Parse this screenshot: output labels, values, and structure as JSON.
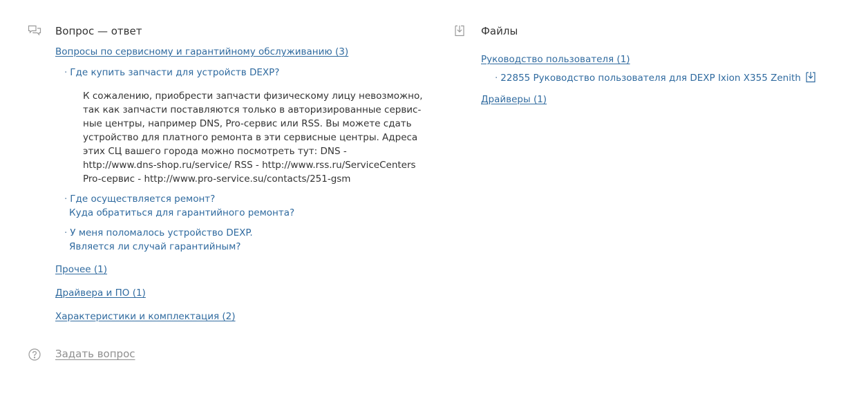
{
  "faq": {
    "icon": "chat-bubbles-icon",
    "title": "Вопрос — ответ",
    "category_service": "Вопросы по сервисному и гарантийному обслуживанию (3)",
    "question1": "Где купить запчасти для устройств DEXP?",
    "answer1_lines": [
      "К сожалению, приобрести запчасти физическому лицу невозможно,",
      "так как запчасти поставляются только в авторизированные сервис-",
      "ные центры, например DNS, Pro-сервис или RSS. Вы можете сдать",
      "устройство для платного ремонта в эти сервисные центры. Адреса",
      "этих СЦ вашего города можно посмотреть тут: DNS -",
      "http://www.dns-shop.ru/service/ RSS - http://www.rss.ru/ServiceCenters",
      "Pro-сервис - http://www.pro-service.su/contacts/251-gsm"
    ],
    "question2_line1": "Где осуществляется ремонт?",
    "question2_line2": "Куда обратиться для гарантийного ремонта?",
    "question3_line1": "У меня поломалось устройство DEXP.",
    "question3_line2": "Является ли случай гарантийным?",
    "category_other": "Прочее (1)",
    "category_drivers": "Драйвера и ПО (1)",
    "category_specs": "Характеристики и комплектация (2)",
    "ask_icon": "question-circle-icon",
    "ask_label": "Задать вопрос"
  },
  "files": {
    "icon": "download-icon",
    "title": "Файлы",
    "category_manual": "Руководство пользователя (1)",
    "file1": "22855 Руководство пользователя для DEXP Ixion X355 Zenith",
    "file1_icon": "download-icon",
    "category_drivers": "Драйверы (1)"
  },
  "colors": {
    "link": "#2f6a9f",
    "text": "#333333",
    "muted": "#8f8f8f",
    "icon": "#9a9a9a"
  }
}
